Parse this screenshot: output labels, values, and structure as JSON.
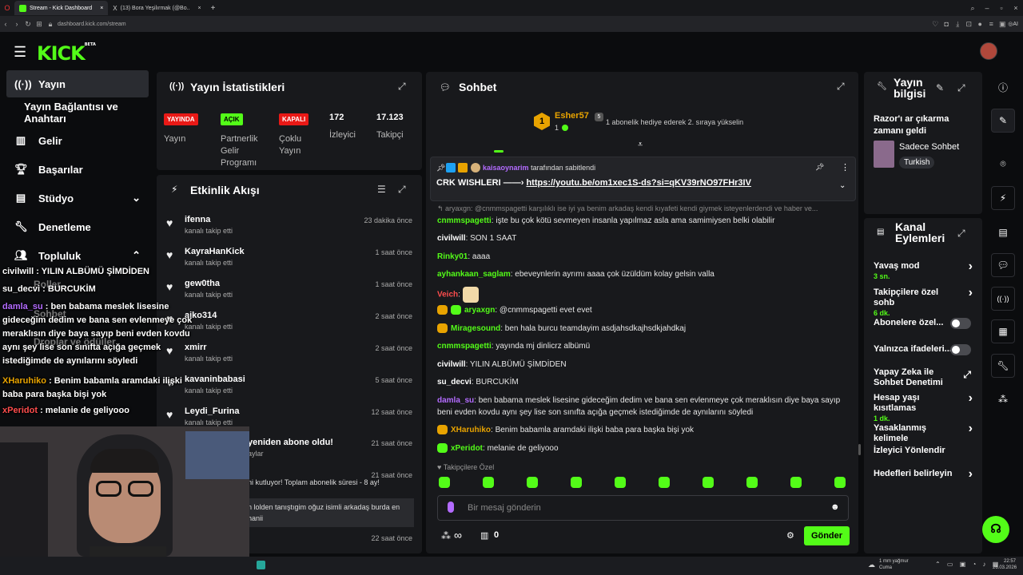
{
  "browser": {
    "tabs": [
      {
        "label": "Stream - Kick Dashboard",
        "color": "#53fc18"
      },
      {
        "label": "(13) Bora Yeşilırmak (@Bo..",
        "color": "#1d9bf0"
      }
    ],
    "url": "dashboard.kick.com/stream"
  },
  "header": {
    "logo": "KICK",
    "logo_sup": "BETA"
  },
  "sidebar": {
    "items": [
      {
        "label": "Yayın",
        "icon": "broadcast-icon"
      },
      {
        "label": "Yayın Bağlantısı ve Anahtarı",
        "icon": ""
      },
      {
        "label": "Gelir",
        "icon": "chart-icon"
      },
      {
        "label": "Başarılar",
        "icon": "trophy-icon"
      },
      {
        "label": "Stüdyo",
        "icon": "studio-icon"
      },
      {
        "label": "Denetleme",
        "icon": "wrench-icon"
      },
      {
        "label": "Topluluk",
        "icon": "community-icon"
      }
    ],
    "hidden_items": [
      "Roller",
      "Sohbet",
      "Droplar ve ödüller"
    ]
  },
  "stats": {
    "title": "Yayın İstatistikleri",
    "badges": [
      {
        "badge": "YAYINDA",
        "label": "Yayın",
        "color": "#e91916"
      },
      {
        "badge": "AÇIK",
        "label": "Partnerlik Gelir Programı",
        "color": "#53fc18"
      },
      {
        "badge": "KAPALI",
        "label": "Çoklu Yayın",
        "color": "#e91916"
      }
    ],
    "viewers_value": "172",
    "viewers_label": "İzleyici",
    "followers_value": "17.123",
    "followers_label": "Takipçi"
  },
  "activity": {
    "title": "Etkinlik Akışı",
    "items": [
      {
        "name": "ifenna",
        "sub": "kanalı takip etti",
        "time": "23 dakika önce"
      },
      {
        "name": "KayraHanKick",
        "sub": "kanalı takip etti",
        "time": "1 saat önce"
      },
      {
        "name": "gew0tha",
        "sub": "kanalı takip etti",
        "time": "1 saat önce"
      },
      {
        "name": "aiko314",
        "sub": "kanalı takip etti",
        "time": "2 saat önce"
      },
      {
        "name": "xmirr",
        "sub": "kanalı takip etti",
        "time": "2 saat önce"
      },
      {
        "name": "kavaninbabasi",
        "sub": "kanalı takip etti",
        "time": "5 saat önce"
      },
      {
        "name": "Leydi_Furina",
        "sub": "kanalı takip etti",
        "time": "12 saat önce"
      },
      {
        "name": "yeniden abone oldu!",
        "sub": "aylar",
        "time": "21 saat önce"
      },
      {
        "name": "",
        "sub": "ni kutluyor! Toplam abonelik süresi - 8 ay!",
        "time": "21 saat önce"
      },
      {
        "name": "",
        "sub": "n lolden tanıştıgim oğuz isimli arkadaş burda en hanii",
        "time": ""
      },
      {
        "name": "",
        "sub": "",
        "time": "22 saat önce"
      }
    ]
  },
  "chat": {
    "title": "Sohbet",
    "gifter": {
      "name": "Esher57",
      "rank": "1",
      "count": "1",
      "gift_count": "5",
      "message": "1 abonelik hediye ederek 2. sıraya yükselin"
    },
    "pinned": {
      "user": "kaisaoynarim",
      "action": "tarafından sabitlendi",
      "text": "CRK WISHLERI ——›",
      "link": "https://youtu.be/om1xec1S-ds?si=qKV39rNO97FHr3IV"
    },
    "reply_preview": "↰ aryaxgn: @cnmmspagetti karşılıklı ise iyi ya benim arkadaş kendi kıyafeti kendi giymek isteyenlerdendi ve haber ve...",
    "messages": [
      {
        "user": "cnmmspagetti",
        "color": "#53fc18",
        "text": "işte bu çok kötü sevmeyen insanla yapılmaz asla ama samimiysen belki olabilir"
      },
      {
        "user": "civilwill",
        "color": "#ffffff",
        "text": "SON 1 SAAT"
      },
      {
        "user": "Rinky01",
        "color": "#53fc18",
        "text": "aaaa"
      },
      {
        "user": "ayhankaan_saglam",
        "color": "#53fc18",
        "text": "ebeveynlerin ayrımı aaaa çok üzüldüm kolay gelsin valla"
      },
      {
        "user": "Veich",
        "color": "#ff4d4d",
        "text": ""
      },
      {
        "user": "aryaxgn",
        "color": "#53fc18",
        "text": "@cnmmspagetti evet evet"
      },
      {
        "user": "Miragesound",
        "color": "#53fc18",
        "text": "ben hala burcu teamdayim asdjahsdkajhsdkjahdkaj"
      },
      {
        "user": "cnmmspagetti",
        "color": "#53fc18",
        "text": "yayında mj dinlicrz albümü"
      },
      {
        "user": "civilwill",
        "color": "#ffffff",
        "text": "YILIN ALBÜMÜ ŞİMDİDEN"
      },
      {
        "user": "su_decvi",
        "color": "#ffffff",
        "text": "BURCUKİM"
      },
      {
        "user": "damla_su",
        "color": "#b36bff",
        "text": "ben babama meslek lisesine gideceğim dedim ve bana sen evlenmeye çok meraklısın diye baya sayıp beni evden kovdu aynı şey lise son sınıfta açığa geçmek istediğimde de aynılarını söyledi"
      },
      {
        "user": "XHaruhiko",
        "color": "#e8a300",
        "text": "Benim babamla aramdaki ilişki baba para başka bişi yok"
      },
      {
        "user": "xPeridot",
        "color": "#53fc18",
        "text": "melanie de geliyooo"
      }
    ],
    "followers_only": "Takipçilere Özel",
    "input_placeholder": "Bir mesaj gönderin",
    "points": "∞",
    "gifts": "0",
    "send_label": "Gönder"
  },
  "stream_info": {
    "title": "Yayın bilgisi",
    "stream_title": "Razor'ı ar     çıkarma zamanı geldi",
    "category": "Sadece Sohbet",
    "language": "Turkish"
  },
  "channel_actions": {
    "title": "Kanal Eylemleri",
    "items": [
      {
        "label": "Yavaş mod",
        "sub": "3 sn.",
        "control": "chevron"
      },
      {
        "label": "Takipçilere özel sohb",
        "sub": "6 dk.",
        "control": "chevron"
      },
      {
        "label": "Abonelere özel...",
        "sub": "",
        "control": "toggle"
      },
      {
        "label": "Yalnızca ifadeleri...",
        "sub": "",
        "control": "toggle"
      },
      {
        "label": "Yapay Zeka ile Sohbet Denetimi",
        "sub": "",
        "control": "external"
      },
      {
        "label": "Hesap yaşı kısıtlamas",
        "sub": "1 dk.",
        "control": "chevron"
      },
      {
        "label": "Yasaklanmış kelimele",
        "sub": "",
        "control": "chevron"
      },
      {
        "label": "İzleyici Yönlendir",
        "sub": "",
        "control": "none"
      },
      {
        "label": "Hedefleri belirleyin",
        "sub": "",
        "control": "chevron"
      }
    ]
  },
  "overlay_chat": [
    {
      "user": "civilwill",
      "color": "#ffffff",
      "text": "YILIN ALBÜMÜ ŞİMDİDEN"
    },
    {
      "user": "su_decvi",
      "color": "#ffffff",
      "text": "BURCUKİM"
    },
    {
      "user": "damla_su",
      "color": "#b36bff",
      "text": "ben babama meslek lisesine gideceğim dedim ve bana sen evlenmeye çok meraklısın diye baya sayıp beni evden kovdu aynı şey lise son sınıfta açığa geçmek istediğimde de aynılarını söyledi"
    },
    {
      "user": "XHaruhiko",
      "color": "#e8a300",
      "text": "Benim babamla aramdaki ilişki baba para başka bişi yok"
    },
    {
      "user": "xPeridot",
      "color": "#ff4d4d",
      "text": "melanie de geliyooo"
    }
  ],
  "taskbar": {
    "weather": "1 mm yağmur",
    "weather_day": "Cuma",
    "time": "22:57",
    "date": "26.03.2026"
  }
}
